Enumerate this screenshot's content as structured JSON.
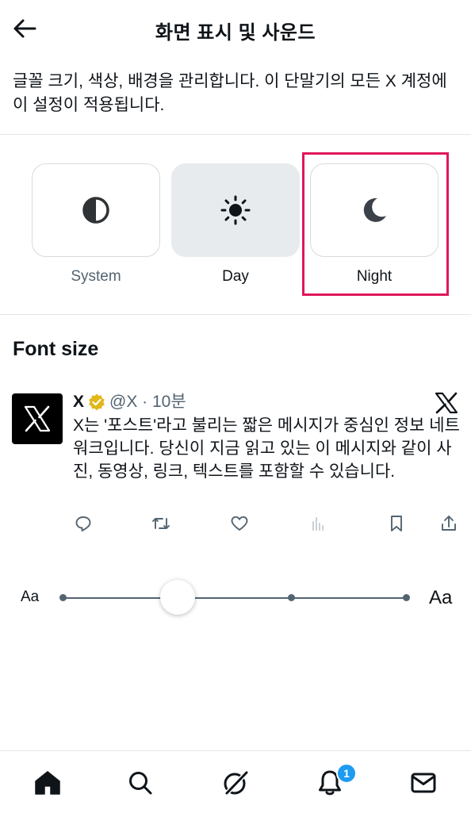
{
  "header": {
    "title": "화면 표시 및 사운드"
  },
  "description": "글꼴 크기, 색상, 배경을 관리합니다. 이 단말기의 모든 X 계정에 이 설정이 적용됩니다.",
  "themes": {
    "system_label": "System",
    "day_label": "Day",
    "night_label": "Night"
  },
  "font_size": {
    "title": "Font size",
    "small_label": "Aa",
    "large_label": "Aa",
    "selected_level": 2,
    "levels": 5
  },
  "post": {
    "name": "X",
    "handle": "@X · 10분",
    "text": "X는 '포스트'라고 불리는 짧은 메시지가 중심인 정보 네트워크입니다. 당신이 지금 읽고 있는 이 메시지와 같이 사진, 동영상, 링크, 텍스트를 포함할 수 있습니다."
  },
  "tabbar": {
    "notification_count": "1"
  },
  "colors": {
    "highlight": "#e0165c",
    "badge": "#1d9bf0",
    "verified": "#e2b719"
  }
}
